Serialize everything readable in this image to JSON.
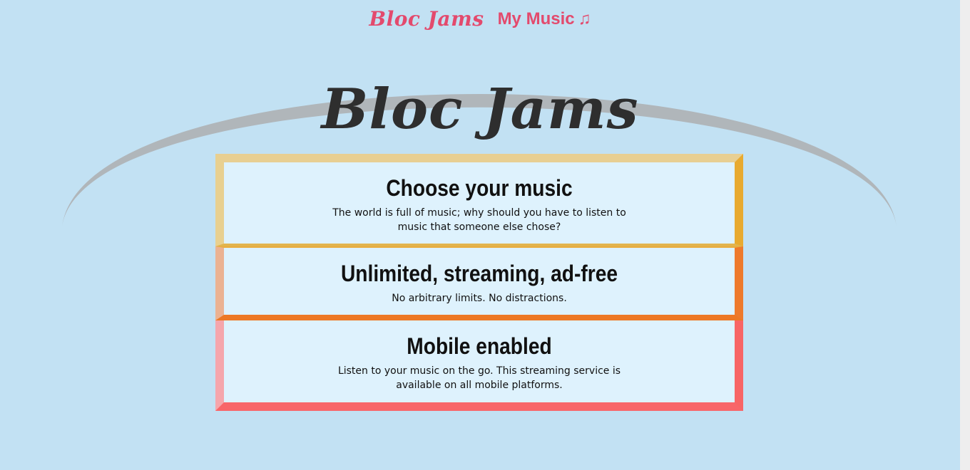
{
  "nav": {
    "logo": "Bloc Jams",
    "my_music_label": "My Music",
    "my_music_icon": "♫"
  },
  "hero": {
    "title": "Bloc Jams"
  },
  "selling_points": [
    {
      "title": "Choose your music",
      "description": "The world is full of music; why should you have to listen to music that someone else chose?"
    },
    {
      "title": "Unlimited, streaming, ad-free",
      "description": "No arbitrary limits. No distractions."
    },
    {
      "title": "Mobile enabled",
      "description": "Listen to your music on the go. This streaming service is available on all mobile platforms."
    }
  ],
  "colors": {
    "background": "#c2e1f3",
    "accent": "#e34a6d",
    "arc": "#b0b6ba",
    "card_background": "#def2fd"
  }
}
